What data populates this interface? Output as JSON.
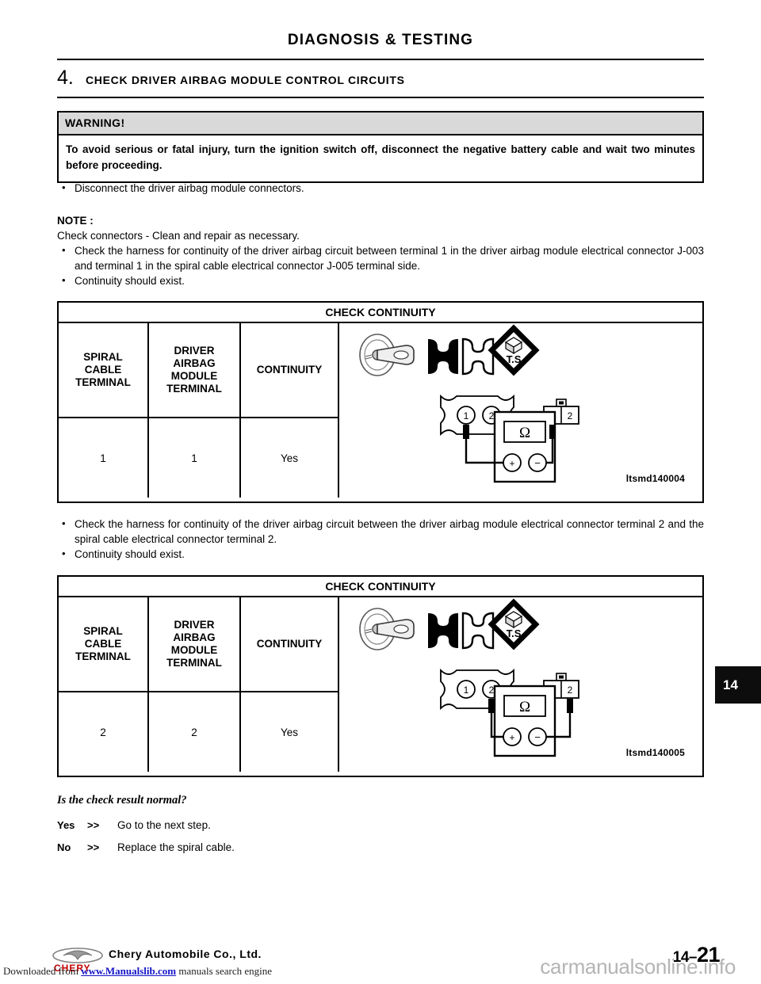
{
  "document": {
    "title": "DIAGNOSIS & TESTING"
  },
  "step": {
    "number": "4.",
    "title": "CHECK DRIVER AIRBAG MODULE CONTROL CIRCUITS"
  },
  "warning": {
    "heading": "WARNING!",
    "body": "To avoid serious or fatal injury, turn the ignition switch off, disconnect the negative battery cable and wait two minutes before proceeding."
  },
  "intro_bullets": [
    "Disconnect the driver airbag module connectors."
  ],
  "note": {
    "label": "NOTE :",
    "text": "Check connectors - Clean and repair as necessary.",
    "bullets": [
      "Check the harness for continuity of the driver airbag circuit between terminal 1 in the driver airbag module electrical connector J-003 and terminal 1 in the spiral cable electrical connector J-005 terminal side.",
      "Continuity should exist."
    ]
  },
  "table1": {
    "title": "CHECK CONTINUITY",
    "headers": [
      "SPIRAL\nCABLE\nTERMINAL",
      "DRIVER\nAIRBAG\nMODULE\nTERMINAL",
      "CONTINUITY"
    ],
    "header_lines": [
      [
        "SPIRAL",
        "CABLE",
        "TERMINAL"
      ],
      [
        "DRIVER",
        "AIRBAG",
        "MODULE",
        "TERMINAL"
      ],
      [
        "CONTINUITY"
      ]
    ],
    "row": [
      "1",
      "1",
      "Yes"
    ],
    "figure": {
      "caption": "ltsmd140004",
      "icons": [
        "ignition-key-off-icon",
        "disconnected-connector-icon",
        "ts-diamond-icon"
      ],
      "ts_label": "T.S",
      "meter_symbol": "Ω",
      "meter_positive": "+",
      "meter_negative": "−",
      "spiral_pins": [
        "1",
        "2"
      ],
      "module_pins": [
        "1",
        "2"
      ],
      "probed_spiral_pin": "1",
      "probed_module_pin": "1"
    }
  },
  "mid_bullets": [
    "Check the harness for continuity of the driver airbag circuit between the driver airbag module electrical connector terminal 2 and the spiral cable electrical connector terminal 2.",
    "Continuity should exist."
  ],
  "table2": {
    "title": "CHECK CONTINUITY",
    "header_lines": [
      [
        "SPIRAL",
        "CABLE",
        "TERMINAL"
      ],
      [
        "DRIVER",
        "AIRBAG",
        "MODULE",
        "TERMINAL"
      ],
      [
        "CONTINUITY"
      ]
    ],
    "row": [
      "2",
      "2",
      "Yes"
    ],
    "figure": {
      "caption": "ltsmd140005",
      "icons": [
        "ignition-key-off-icon",
        "disconnected-connector-icon",
        "ts-diamond-icon"
      ],
      "ts_label": "T.S",
      "meter_symbol": "Ω",
      "meter_positive": "+",
      "meter_negative": "−",
      "spiral_pins": [
        "1",
        "2"
      ],
      "module_pins": [
        "1",
        "2"
      ],
      "probed_spiral_pin": "2",
      "probed_module_pin": "2"
    }
  },
  "decision": {
    "question": "Is the check result normal?",
    "answers": [
      {
        "key": "Yes",
        "arrow": ">>",
        "text": "Go to the next step."
      },
      {
        "key": "No",
        "arrow": ">>",
        "text": "Replace the spiral cable."
      }
    ]
  },
  "chapter_tab": "14",
  "footer": {
    "company": "Chery Automobile Co., Ltd.",
    "brand_word": "CHERY",
    "page_prefix": "14–",
    "page_number": "21",
    "watermark": "carmanualsonline.info",
    "download_prefix": "Downloaded from ",
    "download_link": "www.Manualslib.com",
    "download_suffix": " manuals search engine"
  },
  "colors": {
    "warning_header_bg": "#d9d9d9",
    "chapter_tab_bg": "#0d0d0d",
    "watermark": "#b4b4b4",
    "link": "#1414c8",
    "brand_red": "#c00000"
  }
}
